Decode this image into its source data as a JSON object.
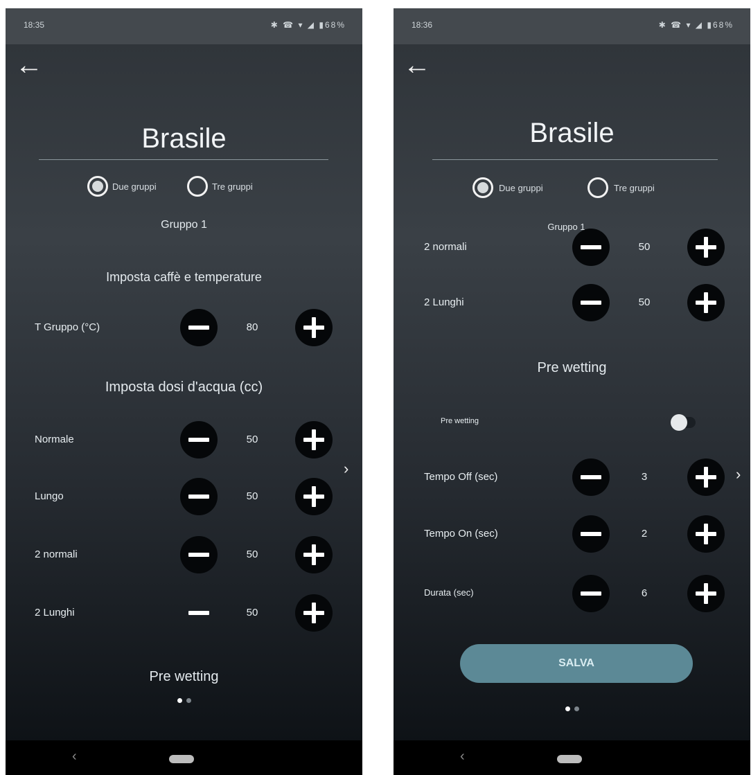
{
  "left_screen": {
    "statusbar": {
      "time": "18:35",
      "icons": "✱ ☎ ▾ ◢ ▮68%"
    },
    "back_label": "←",
    "title": "Brasile",
    "radio": {
      "option1": "Due gruppi",
      "option2": "Tre gruppi"
    },
    "group_label": "Gruppo 1",
    "section_coffee": "Imposta caffè e temperature",
    "temp_row": {
      "label": "T Gruppo (°C)",
      "value": "80"
    },
    "section_water": "Imposta dosi d'acqua (cc)",
    "water_rows": [
      {
        "label": "Normale",
        "value": "50"
      },
      {
        "label": "Lungo",
        "value": "50"
      },
      {
        "label": "2 normali",
        "value": "50"
      },
      {
        "label": "2 Lunghi",
        "value": "50"
      }
    ],
    "footer_text": "Pre wetting",
    "chevron": "›",
    "nav": {
      "back": "‹"
    }
  },
  "right_screen": {
    "statusbar": {
      "time": "18:36",
      "icons": "✱ ☎ ▾ ◢ ▮68%"
    },
    "back_label": "←",
    "title": "Brasile",
    "radio": {
      "option1": "Due gruppi",
      "option2": "Tre gruppi"
    },
    "group_label": "Gruppo 1",
    "water_rows": [
      {
        "label": "2 normali",
        "value": "50"
      },
      {
        "label": "2 Lunghi",
        "value": "50"
      }
    ],
    "section_prewetting": "Pre wetting",
    "toggle_label": "Pre wetting",
    "timing_rows": [
      {
        "label": "Tempo Off (sec)",
        "value": "3"
      },
      {
        "label": "Tempo On (sec)",
        "value": "2"
      },
      {
        "label": "Durata (sec)",
        "value": "6"
      }
    ],
    "save_label": "SALVA",
    "chevron": "›",
    "nav": {
      "back": "‹"
    }
  }
}
